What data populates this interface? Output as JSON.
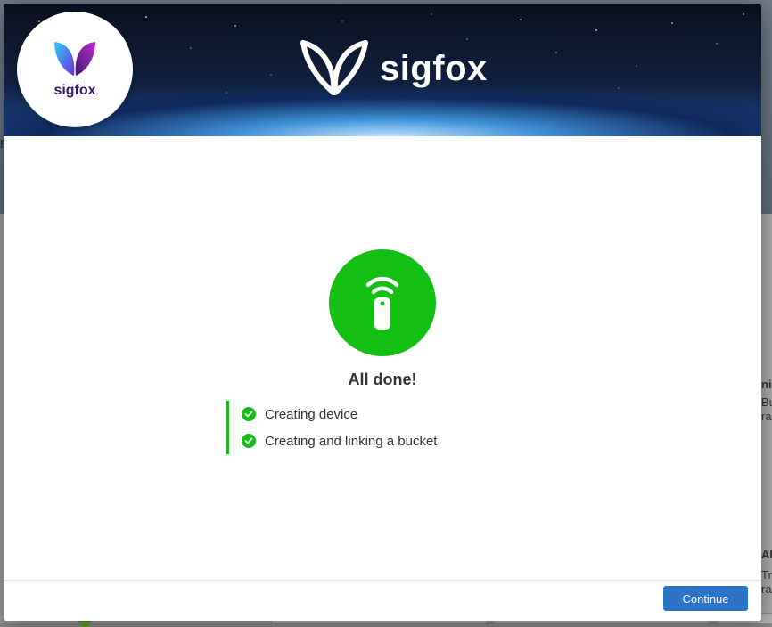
{
  "modal": {
    "hero_brand": "sigfox",
    "badge_brand": "sigfox",
    "status_title": "All done!",
    "steps": [
      {
        "label": "Creating device",
        "icon": "check-circle-icon"
      },
      {
        "label": "Creating and linking a bucket",
        "icon": "check-circle-icon"
      }
    ],
    "continue_label": "Continue"
  },
  "background": {
    "fragments": [
      "E",
      "ni",
      "Bu",
      "ra",
      "Al",
      "Tra",
      "ra"
    ]
  },
  "colors": {
    "success": "#12bf12",
    "primary_button": "#2b74c7",
    "brand_purple": "#3a1a6e"
  },
  "icons": {
    "status": "remote-signal-icon",
    "hero_logo": "sigfox-logo-icon",
    "badge_logo": "sigfox-butterfly-icon"
  }
}
